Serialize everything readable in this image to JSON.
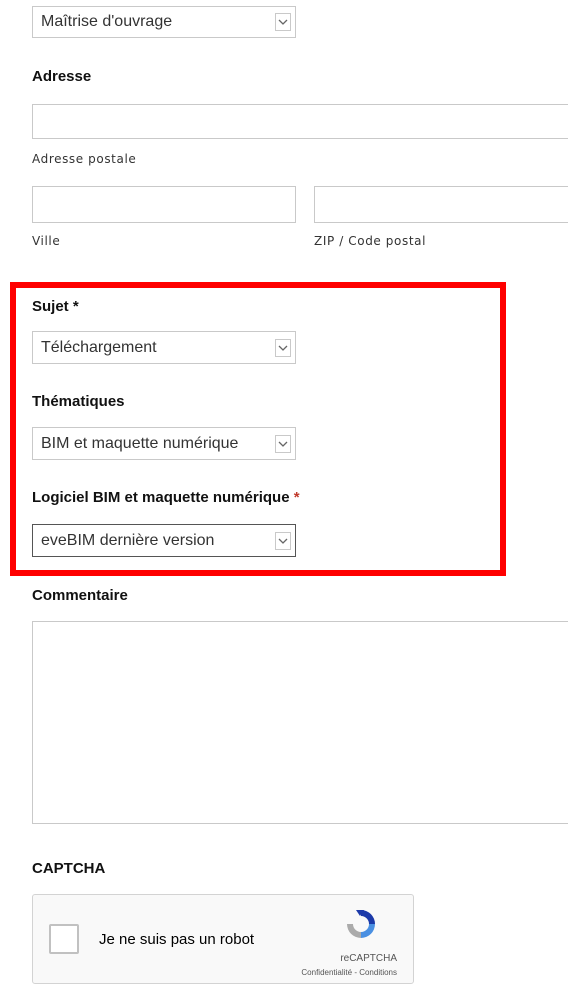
{
  "profile_select": {
    "value": "Maîtrise d'ouvrage"
  },
  "address": {
    "title": "Adresse",
    "street_hint": "Adresse postale",
    "city_hint": "Ville",
    "zip_hint": "ZIP / Code postal"
  },
  "subject": {
    "label": "Sujet",
    "required_mark": "*",
    "value": "Téléchargement"
  },
  "themes": {
    "label": "Thématiques",
    "value": "BIM et maquette numérique"
  },
  "software": {
    "label": "Logiciel BIM et maquette numérique",
    "required_mark": "*",
    "value": "eveBIM dernière version"
  },
  "comment": {
    "label": "Commentaire"
  },
  "captcha": {
    "title": "CAPTCHA",
    "checkbox_label": "Je ne suis pas un robot",
    "brand": "reCAPTCHA",
    "links": "Confidentialité - Conditions"
  },
  "colors": {
    "highlight": "#ff0000",
    "required": "#c0392b"
  },
  "icons": [
    "chevron-down-icon",
    "recaptcha-logo-icon"
  ]
}
